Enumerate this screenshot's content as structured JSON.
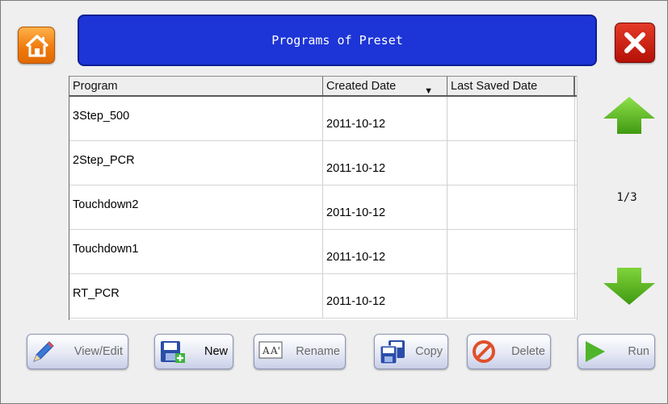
{
  "header": {
    "title": "Programs of Preset",
    "home_icon": "home-icon",
    "close_icon": "close-icon",
    "colors": {
      "title_bg": "#1d35d6",
      "home_bg": "#f07c10",
      "close_bg": "#c01a0e"
    }
  },
  "table": {
    "columns": [
      "Program",
      "Created Date",
      "Last Saved Date"
    ],
    "sort_indicator": "▼",
    "sorted_column": "Created Date",
    "rows": [
      {
        "program": "3Step_500",
        "created": "2011-10-12",
        "last_saved": ""
      },
      {
        "program": "2Step_PCR",
        "created": "2011-10-12",
        "last_saved": ""
      },
      {
        "program": "Touchdown2",
        "created": "2011-10-12",
        "last_saved": ""
      },
      {
        "program": "Touchdown1",
        "created": "2011-10-12",
        "last_saved": ""
      },
      {
        "program": "RT_PCR",
        "created": "2011-10-12",
        "last_saved": ""
      }
    ]
  },
  "pager": {
    "indicator": "1/3",
    "up_icon": "arrow-up-icon",
    "down_icon": "arrow-down-icon",
    "arrow_color": "#5fb820"
  },
  "toolbar": {
    "view_edit": "View/Edit",
    "new": "New",
    "rename": "Rename",
    "copy": "Copy",
    "delete": "Delete",
    "run": "Run"
  }
}
